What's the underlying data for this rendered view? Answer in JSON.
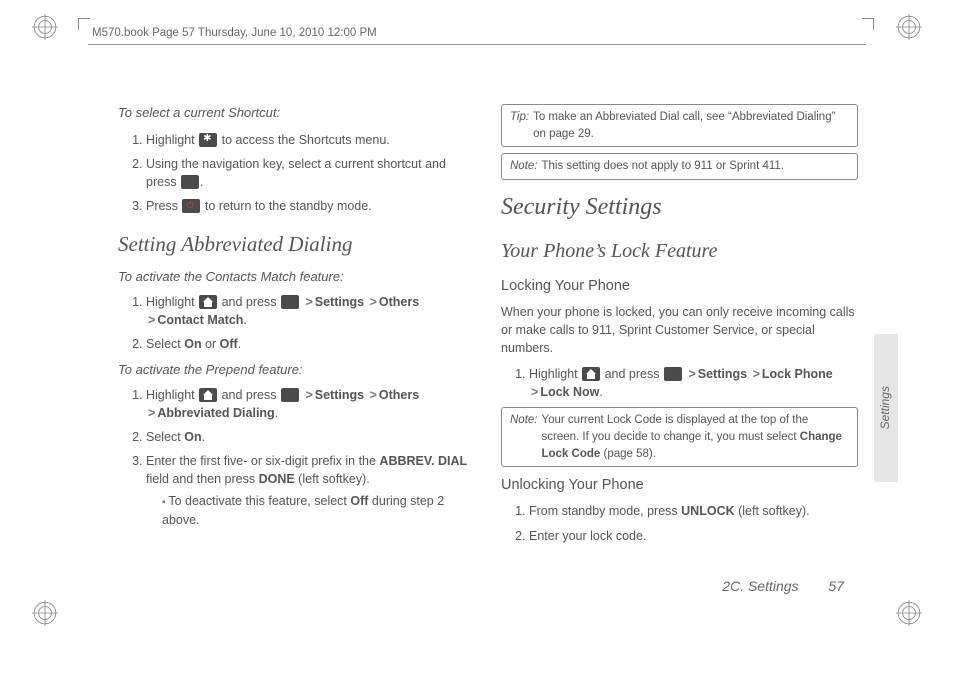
{
  "header": "M570.book  Page 57  Thursday, June 10, 2010  12:00 PM",
  "left": {
    "lead1": "To select a current Shortcut:",
    "s1": {
      "a": "Highlight ",
      "b": " to access the Shortcuts menu."
    },
    "s2": {
      "a": "Using the navigation key, select a current shortcut and press ",
      "b": "."
    },
    "s3": {
      "a": "Press ",
      "b": " to return to the standby mode."
    },
    "h2a": "Setting Abbreviated Dialing",
    "lead2": "To activate the Contacts Match feature:",
    "s4": {
      "a": "Highlight ",
      "b": " and press ",
      "c": "Settings",
      "d": "Others",
      "e": "Contact Match",
      "end": "."
    },
    "s5": {
      "a": "Select ",
      "b": "On",
      "c": " or ",
      "d": "Off",
      "e": "."
    },
    "lead3": "To activate the Prepend feature:",
    "s6": {
      "a": "Highlight ",
      "b": " and press ",
      "c": "Settings",
      "d": "Others",
      "e": "Abbreviated Dialing",
      "end": "."
    },
    "s7": {
      "a": "Select ",
      "b": "On",
      "c": "."
    },
    "s8": {
      "a": "Enter the first five- or six-digit prefix in the ",
      "b": "ABBREV. DIAL",
      "c": " field and then press ",
      "d": "DONE",
      "e": " (left softkey)."
    },
    "sub8": {
      "a": "To deactivate this feature, select ",
      "b": "Off",
      "c": " during step 2 above."
    }
  },
  "right": {
    "tip": {
      "lbl": "Tip:",
      "txt": "To make an Abbreviated Dial call, see “Abbreviated Dialing” on page 29."
    },
    "note1": {
      "lbl": "Note:",
      "txt": "This setting does not apply to 911 or Sprint 411."
    },
    "h1": "Security Settings",
    "h3": "Your Phone’s Lock Feature",
    "h4a": "Locking Your Phone",
    "p1": "When your phone is locked, you can only receive incoming calls or make calls to 911, Sprint Customer Service, or special numbers.",
    "r1": {
      "a": "Highlight ",
      "b": " and press ",
      "c": "Settings",
      "d": "Lock Phone",
      "e": "Lock Now",
      "end": "."
    },
    "note2": {
      "lbl": "Note:",
      "txt_a": "Your current Lock Code is displayed at the top of the screen. If you decide to change it, you must select ",
      "txt_b": "Change Lock Code",
      "txt_c": " (page 58)."
    },
    "h4b": "Unlocking Your Phone",
    "r2": {
      "a": "From standby mode, press ",
      "b": "UNLOCK",
      "c": " (left softkey)."
    },
    "r3": "Enter your lock code."
  },
  "sideTab": "Settings",
  "footer": {
    "sec": "2C. Settings",
    "pg": "57"
  },
  "gt": ">"
}
